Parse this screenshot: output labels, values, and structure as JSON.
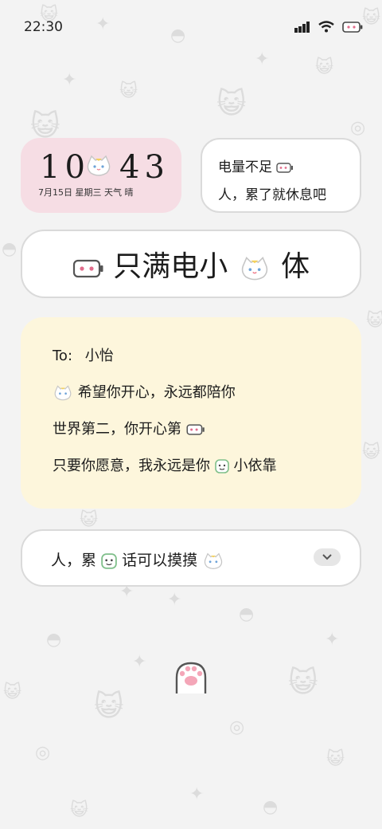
{
  "status_bar": {
    "time": "22:30"
  },
  "widget_clock": {
    "hour": "10",
    "minute": "43",
    "date_line": "7月15日 星期三 天气 晴"
  },
  "widget_msg": {
    "line1": "电量不足",
    "line2": "人，累了就休息吧"
  },
  "banner": {
    "text_left": "只满电小",
    "text_right": "体"
  },
  "note": {
    "to_label": "To:",
    "to_name": "小怡",
    "line1": "希望你开心，永远都陪你",
    "line2": "世界第二，你开心第",
    "line3_a": "只要你愿意，我永远是你",
    "line3_b": "小依靠"
  },
  "bottom_bar": {
    "text_a": "人，累",
    "text_b": "话可以摸摸"
  },
  "colors": {
    "pink_card": "#f6dde4",
    "note_bg": "#fdf6dc",
    "border": "#dadada"
  }
}
